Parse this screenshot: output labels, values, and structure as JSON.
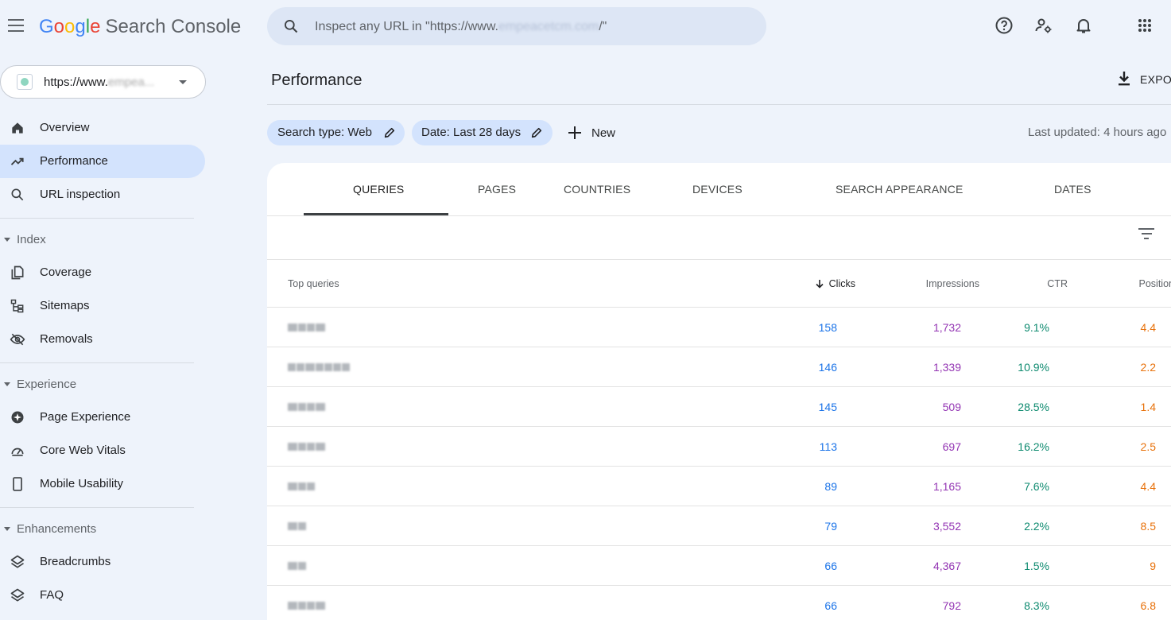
{
  "app": {
    "logo_google": [
      "G",
      "o",
      "o",
      "g",
      "l",
      "e"
    ],
    "logo_suffix": "Search Console"
  },
  "search": {
    "placeholder_prefix": "Inspect any URL in \"https://www.",
    "placeholder_blurred": "empeacetcm.com",
    "placeholder_suffix": "/\""
  },
  "property": {
    "url_prefix": "https://www.",
    "url_blurred": "empea..."
  },
  "sidebar": {
    "items": [
      {
        "label": "Overview",
        "icon": "home-icon"
      },
      {
        "label": "Performance",
        "icon": "trending-up-icon",
        "active": true
      },
      {
        "label": "URL inspection",
        "icon": "search-icon"
      }
    ],
    "sections": [
      {
        "title": "Index",
        "items": [
          {
            "label": "Coverage",
            "icon": "coverage-icon"
          },
          {
            "label": "Sitemaps",
            "icon": "sitemap-icon"
          },
          {
            "label": "Removals",
            "icon": "visibility-off-icon"
          }
        ]
      },
      {
        "title": "Experience",
        "items": [
          {
            "label": "Page Experience",
            "icon": "page-experience-icon"
          },
          {
            "label": "Core Web Vitals",
            "icon": "speed-gauge-icon"
          },
          {
            "label": "Mobile Usability",
            "icon": "smartphone-icon"
          }
        ]
      },
      {
        "title": "Enhancements",
        "items": [
          {
            "label": "Breadcrumbs",
            "icon": "layers-icon"
          },
          {
            "label": "FAQ",
            "icon": "layers-icon"
          }
        ]
      }
    ]
  },
  "header": {
    "title": "Performance",
    "export_label": "EXPO"
  },
  "filters": {
    "search_type": "Search type: Web",
    "date": "Date: Last 28 days",
    "new_label": "New",
    "last_updated": "Last updated: 4 hours ago"
  },
  "tabs": [
    "QUERIES",
    "PAGES",
    "COUNTRIES",
    "DEVICES",
    "SEARCH APPEARANCE",
    "DATES"
  ],
  "table": {
    "columns": {
      "query": "Top queries",
      "clicks": "Clicks",
      "impressions": "Impressions",
      "ctr": "CTR",
      "position": "Position"
    },
    "rows": [
      {
        "clicks": "158",
        "impressions": "1,732",
        "ctr": "9.1%",
        "position": "4.4"
      },
      {
        "clicks": "146",
        "impressions": "1,339",
        "ctr": "10.9%",
        "position": "2.2"
      },
      {
        "clicks": "145",
        "impressions": "509",
        "ctr": "28.5%",
        "position": "1.4"
      },
      {
        "clicks": "113",
        "impressions": "697",
        "ctr": "16.2%",
        "position": "2.5"
      },
      {
        "clicks": "89",
        "impressions": "1,165",
        "ctr": "7.6%",
        "position": "4.4"
      },
      {
        "clicks": "79",
        "impressions": "3,552",
        "ctr": "2.2%",
        "position": "8.5"
      },
      {
        "clicks": "66",
        "impressions": "4,367",
        "ctr": "1.5%",
        "position": "9"
      },
      {
        "clicks": "66",
        "impressions": "792",
        "ctr": "8.3%",
        "position": "6.8"
      }
    ]
  },
  "colors": {
    "background": "#eef3fb",
    "active_nav": "#d3e3fd",
    "clicks": "#1a73e8",
    "impressions": "#9334b3",
    "ctr": "#0d8a6f",
    "position": "#e8710a"
  }
}
